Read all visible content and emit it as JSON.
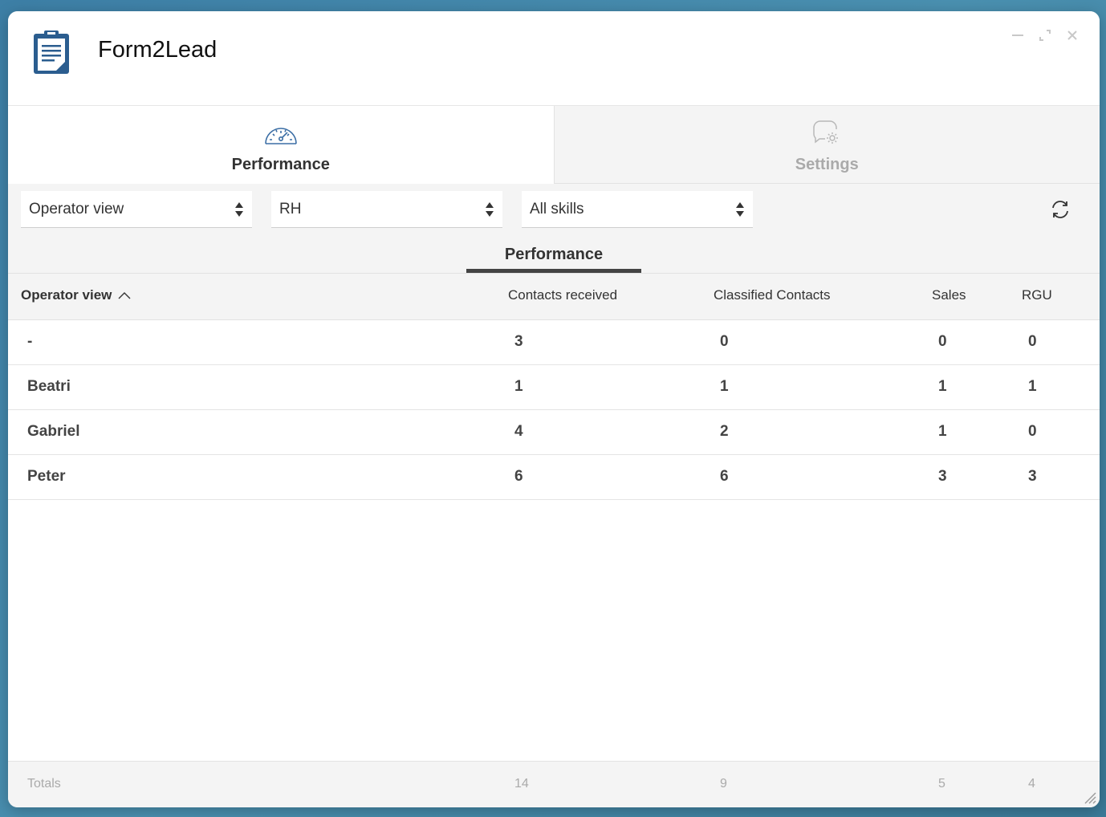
{
  "app": {
    "title": "Form2Lead"
  },
  "tabs": [
    {
      "label": "Performance",
      "icon": "speedometer-icon",
      "active": true
    },
    {
      "label": "Settings",
      "icon": "chat-settings-icon",
      "active": false
    }
  ],
  "filters": {
    "view": {
      "value": "Operator view"
    },
    "group": {
      "value": "RH"
    },
    "skills": {
      "value": "All skills"
    }
  },
  "subtab": {
    "label": "Performance"
  },
  "table": {
    "headers": {
      "name": "Operator view",
      "contacts_received": "Contacts received",
      "classified_contacts": "Classified Contacts",
      "sales": "Sales",
      "rgu": "RGU"
    },
    "sort": "ascending",
    "rows": [
      {
        "name": "-",
        "contacts_received": "3",
        "classified_contacts": "0",
        "sales": "0",
        "rgu": "0"
      },
      {
        "name": "Beatri",
        "contacts_received": "1",
        "classified_contacts": "1",
        "sales": "1",
        "rgu": "1"
      },
      {
        "name": "Gabriel",
        "contacts_received": "4",
        "classified_contacts": "2",
        "sales": "1",
        "rgu": "0"
      },
      {
        "name": "Peter",
        "contacts_received": "6",
        "classified_contacts": "6",
        "sales": "3",
        "rgu": "3"
      }
    ],
    "totals": {
      "label": "Totals",
      "contacts_received": "14",
      "classified_contacts": "9",
      "sales": "5",
      "rgu": "4"
    }
  },
  "colors": {
    "accent": "#2b5d8f",
    "icon_blue": "#3b6ea5",
    "muted": "#aaaaaa"
  }
}
